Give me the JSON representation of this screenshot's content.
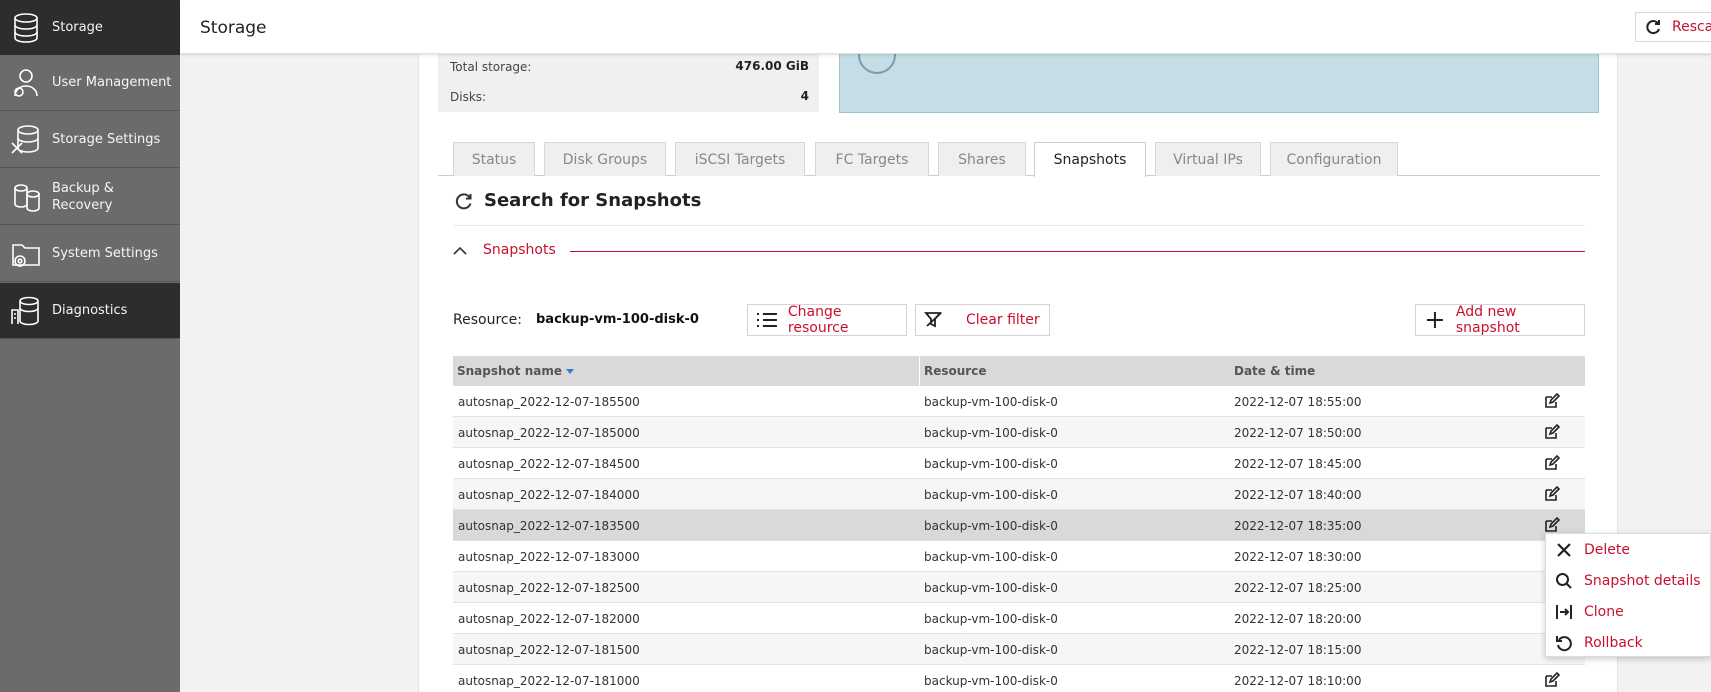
{
  "sidebar": {
    "items": [
      {
        "label": "Storage",
        "icon": "database-icon",
        "active": true
      },
      {
        "label": "User Management",
        "icon": "user-gear-icon"
      },
      {
        "label": "Storage Settings",
        "icon": "database-tools-icon"
      },
      {
        "label": "Backup & Recovery",
        "icon": "backup-stack-icon"
      },
      {
        "label": "System Settings",
        "icon": "folder-gear-icon"
      },
      {
        "label": "Diagnostics",
        "icon": "diagnostics-icon",
        "active": true
      }
    ]
  },
  "header": {
    "title": "Storage",
    "rescan_label": "Rescan"
  },
  "summary": {
    "total_storage_label": "Total storage:",
    "total_storage_value": "476.00 GiB",
    "disks_label": "Disks:",
    "disks_value": "4"
  },
  "tabs": [
    {
      "label": "Status"
    },
    {
      "label": "Disk Groups"
    },
    {
      "label": "iSCSI Targets"
    },
    {
      "label": "FC Targets"
    },
    {
      "label": "Shares"
    },
    {
      "label": "Snapshots",
      "active": true
    },
    {
      "label": "Virtual IPs"
    },
    {
      "label": "Configuration"
    }
  ],
  "section": {
    "title": "Search for Snapshots",
    "collapse_title": "Snapshots"
  },
  "toolbar": {
    "resource_label": "Resource:",
    "resource_value": "backup-vm-100-disk-0",
    "change_resource": "Change resource",
    "clear_filter": "Clear filter",
    "add_new_snapshot": "Add new snapshot"
  },
  "table": {
    "headers": {
      "name": "Snapshot name",
      "resource": "Resource",
      "datetime": "Date & time"
    },
    "rows": [
      {
        "name": "autosnap_2022-12-07-185500",
        "resource": "backup-vm-100-disk-0",
        "datetime": "2022-12-07 18:55:00"
      },
      {
        "name": "autosnap_2022-12-07-185000",
        "resource": "backup-vm-100-disk-0",
        "datetime": "2022-12-07 18:50:00"
      },
      {
        "name": "autosnap_2022-12-07-184500",
        "resource": "backup-vm-100-disk-0",
        "datetime": "2022-12-07 18:45:00"
      },
      {
        "name": "autosnap_2022-12-07-184000",
        "resource": "backup-vm-100-disk-0",
        "datetime": "2022-12-07 18:40:00"
      },
      {
        "name": "autosnap_2022-12-07-183500",
        "resource": "backup-vm-100-disk-0",
        "datetime": "2022-12-07 18:35:00",
        "selected": true
      },
      {
        "name": "autosnap_2022-12-07-183000",
        "resource": "backup-vm-100-disk-0",
        "datetime": "2022-12-07 18:30:00"
      },
      {
        "name": "autosnap_2022-12-07-182500",
        "resource": "backup-vm-100-disk-0",
        "datetime": "2022-12-07 18:25:00"
      },
      {
        "name": "autosnap_2022-12-07-182000",
        "resource": "backup-vm-100-disk-0",
        "datetime": "2022-12-07 18:20:00"
      },
      {
        "name": "autosnap_2022-12-07-181500",
        "resource": "backup-vm-100-disk-0",
        "datetime": "2022-12-07 18:15:00"
      },
      {
        "name": "autosnap_2022-12-07-181000",
        "resource": "backup-vm-100-disk-0",
        "datetime": "2022-12-07 18:10:00"
      }
    ]
  },
  "context_menu": {
    "items": [
      {
        "label": "Delete",
        "icon": "close-icon"
      },
      {
        "label": "Snapshot details",
        "icon": "search-icon"
      },
      {
        "label": "Clone",
        "icon": "clone-icon"
      },
      {
        "label": "Rollback",
        "icon": "rollback-icon"
      }
    ]
  },
  "colors": {
    "accent": "#c8102e",
    "sidebar": "#6b6b6b",
    "sidebar_dark": "#2d2d2d",
    "info_box": "#c5dde5"
  }
}
